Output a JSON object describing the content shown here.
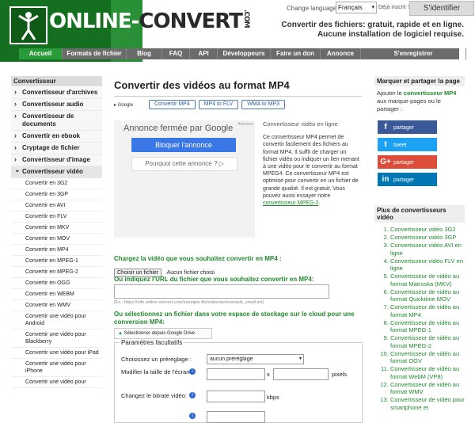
{
  "header": {
    "logo_text_a": "ONLINE-",
    "logo_text_b": "CONVERT",
    "logo_suffix": ".COM",
    "lang_label": "Change language:",
    "lang_value": "Français",
    "member_text": "Déjà inscrit ?",
    "signin_label": "S'identifier",
    "tagline_1": "Convertir des fichiers: gratuit, rapide et en ligne.",
    "tagline_2": "Aucune installation de logiciel requise."
  },
  "nav": {
    "items": [
      {
        "label": "Accueil",
        "w": 54
      },
      {
        "label": "Formats de fichier",
        "w": 80
      },
      {
        "label": "Blog",
        "w": 44
      },
      {
        "label": "FAQ",
        "w": 34
      },
      {
        "label": "API",
        "w": 34
      },
      {
        "label": "Développeurs",
        "w": 66
      },
      {
        "label": "Faire un don",
        "w": 62
      },
      {
        "label": "Annonce",
        "w": 50
      },
      {
        "label": "S'enregistrer",
        "w": 132
      }
    ]
  },
  "sidebar": {
    "head": "Convertisseur",
    "items": [
      "Convertisseur d'archives",
      "Convertisseur audio",
      "Convertisseur de documents",
      "Convertir en ebook",
      "Cryptage de fichier",
      "Convertisseur d'image"
    ],
    "open_item": "Convertisseur vidéo",
    "sub_items": [
      "Convertir en 3G2",
      "Convertir en 3GP",
      "Convertir en AVI",
      "Convertir en FLV",
      "Convertir en MKV",
      "Convertir en MOV",
      "Convertir en MP4",
      "Convertir en MPEG-1",
      "Convertir en MPEG-2",
      "Convertir en OGG",
      "Convertir en WEBM",
      "Convertir en WMV",
      "Convertir une vidéo pour Android",
      "Convertir une vidéo pour Blackberry",
      "Convertir une vidéo pour iPad",
      "Convertir une vidéo pour iPhone",
      "Convertir une vidéo pour"
    ]
  },
  "main": {
    "title": "Convertir des vidéos au format MP4",
    "google_badge": "▸ Google",
    "tabs": [
      "Convertir MP4",
      "MP4 to FLV",
      "WMA to MP3"
    ],
    "ad": {
      "label": "Annonce",
      "title": "Annonce fermée par Google",
      "block_btn": "Bloquer l'annonce",
      "why": "Pourquoi cette annonce ? ▷"
    },
    "desc_title": "Convertisseur vidéo en ligne",
    "desc_body": "Ce convertisseur MP4 permet de convertir facilement des fichiers au format MP4. Il suffit de charger un fichier vidéo ou indiquer un lien menant à une vidéo pour le convertir au format MPEG4. Ce convertisseur MP4 est optimisé pour convertir en un fichier de grande qualité. Il est gratuit. Vous pouvez aussi essayer notre",
    "desc_link": "convertisseur MPEG-2",
    "desc_end": ".",
    "upload_label": "Chargez la vidéo que vous souhaitez convertir en MP4 :",
    "file_btn": "Choisir un fichier",
    "file_none": "Aucun fichier choisi",
    "url_label": "Ou indiquez l'URL du fichier que vous souhaitez convertir en MP4:",
    "url_example": "(Ex.: https://cdn.online-convert.com/example-file/video/avi/example_small.avi)",
    "cloud_label": "Ou sélectionnez un fichier dans votre espace de stockage sur le cloud pour une conversion MP4:",
    "gdrive_label": "Sélectionner depuis Google Drive",
    "options": {
      "legend": "Paramètres facultatifs",
      "preset_label": "Choisissez un préréglage :",
      "preset_value": "aucun préréglage",
      "size_label": "Modifier la taille de l'écran :",
      "size_x": "x",
      "size_unit": "pixels",
      "bitrate_label": "Changez le bitrate vidéo:",
      "bitrate_unit": "kbps"
    }
  },
  "right": {
    "head": "Marquer et partager la page",
    "text_a": "Ajouter le",
    "text_b": "convertisseur MP4",
    "text_c": "aux marque-pages ou le partager :",
    "shares": [
      {
        "icon": "f",
        "label": "partager",
        "color": "#3b5998"
      },
      {
        "icon": "t",
        "label": "tweet",
        "color": "#1da1f2"
      },
      {
        "icon": "G+",
        "label": "partager",
        "color": "#dd4b39"
      },
      {
        "icon": "in",
        "label": "partager",
        "color": "#0077b5"
      }
    ],
    "head2": "Plus de convertisseurs vidéo",
    "list": [
      "Convertisseur vidéo 3G2",
      "Convertisseur vidéo 3GP",
      "Convertisseur vidéo AVI en ligne",
      "Convertisseur vidéo FLV en ligne",
      "Convertisseur de vidéo au format Matroska (MKV)",
      "Convertisseur de vidéo au format Quicktime MOV",
      "Convertisseur de vidéo au format MP4",
      "Convertisseur de vidéo au format MPEG-1",
      "Convertisseur de vidéo au format MPEG-2",
      "Convertisseur de vidéo au format OGV",
      "Convertisseur de vidéo au format WebM (VP8)",
      "Convertisseur de vidéo au format WMV",
      "Convertisseur de vidéo pour smartphone et"
    ]
  }
}
